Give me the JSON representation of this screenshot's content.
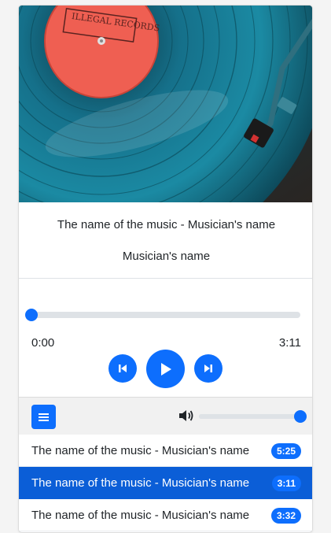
{
  "cover": {
    "alt": "vinyl-record-on-turntable",
    "label_text": "ILLEGAL RECORDS"
  },
  "now_playing": {
    "title": "The name of the music - Musician's name",
    "artist": "Musician's name"
  },
  "player": {
    "current_time": "0:00",
    "total_time": "3:11",
    "progress": 0,
    "prev_icon": "skip-back-icon",
    "play_icon": "play-icon",
    "next_icon": "skip-forward-icon"
  },
  "toolbar": {
    "menu_icon": "list-icon",
    "volume_icon": "volume-icon",
    "volume": 1
  },
  "playlist": [
    {
      "title": "The name of the music - Musician's name",
      "duration": "5:25",
      "active": false
    },
    {
      "title": "The name of the music - Musician's name",
      "duration": "3:11",
      "active": true
    },
    {
      "title": "The name of the music - Musician's name",
      "duration": "3:32",
      "active": false
    }
  ],
  "colors": {
    "accent": "#0d6efd",
    "active_row": "#0b5ed7",
    "track_bg": "#dee2e6",
    "record_label": "#ef5f52",
    "record_vinyl": "#1a7f93"
  }
}
